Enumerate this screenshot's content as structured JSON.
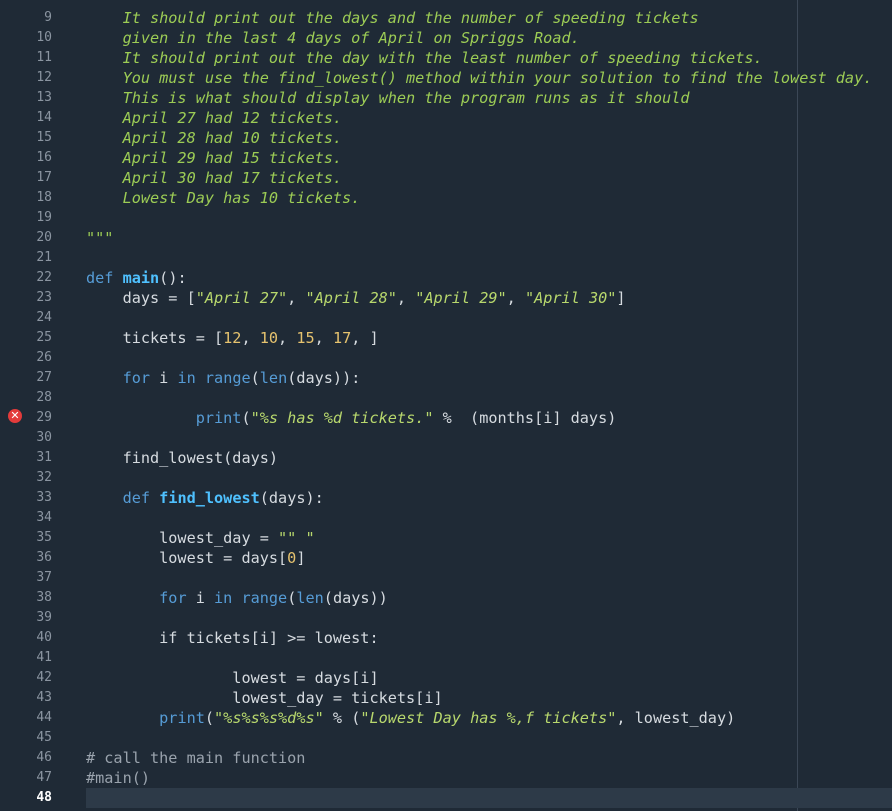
{
  "gutter": {
    "line_numbers": [
      "9",
      "10",
      "11",
      "12",
      "13",
      "14",
      "15",
      "16",
      "17",
      "18",
      "19",
      "20",
      "21",
      "22",
      "23",
      "24",
      "25",
      "26",
      "27",
      "28",
      "29",
      "30",
      "31",
      "32",
      "33",
      "34",
      "35",
      "36",
      "37",
      "38",
      "39",
      "40",
      "41",
      "42",
      "43",
      "44",
      "45",
      "46",
      "47",
      "48"
    ],
    "current_line": "48",
    "error_line": "29",
    "error_glyph": "✕"
  },
  "code": {
    "l9": "    It should print out the days and the number of speeding tickets",
    "l10": "    given in the last 4 days of April on Spriggs Road.",
    "l11": "    It should print out the day with the least number of speeding tickets.",
    "l12": "    You must use the find_lowest() method within your solution to find the lowest day.",
    "l13": "    This is what should display when the program runs as it should",
    "l14": "    April 27 had 12 tickets.",
    "l15": "    April 28 had 10 tickets.",
    "l16": "    April 29 had 15 tickets.",
    "l17": "    April 30 had 17 tickets.",
    "l18": "    Lowest Day has 10 tickets.",
    "l20": "\"\"\"",
    "l22_kw": "def",
    "l22_fn": "main",
    "l22_rest": "():",
    "l23_a": "    days = [",
    "l23_s1": "\"April 27\"",
    "l23_c1": ", ",
    "l23_s2": "\"April 28\"",
    "l23_c2": ", ",
    "l23_s3": "\"April 29\"",
    "l23_c3": ", ",
    "l23_s4": "\"April 30\"",
    "l23_end": "]",
    "l25_a": "    tickets = [",
    "l25_n1": "12",
    "l25_c1": ", ",
    "l25_n2": "10",
    "l25_c2": ", ",
    "l25_n3": "15",
    "l25_c3": ", ",
    "l25_n4": "17",
    "l25_end": ", ]",
    "l27_indent": "    ",
    "l27_for": "for",
    "l27_i": " i ",
    "l27_in": "in",
    "l27_sp": " ",
    "l27_range": "range",
    "l27_p": "(",
    "l27_len": "len",
    "l27_rest": "(days)):",
    "l29_indent": "            ",
    "l29_print": "print",
    "l29_p": "(",
    "l29_str": "\"%s has %d tickets.\"",
    "l29_rest": " %  (months[i] days)",
    "l31": "    find_lowest(days)",
    "l33_indent": "    ",
    "l33_kw": "def",
    "l33_sp": " ",
    "l33_fn": "find_lowest",
    "l33_rest": "(days):",
    "l35_a": "        lowest_day = ",
    "l35_s": "\"\" \"",
    "l36_a": "        lowest = days[",
    "l36_n": "0",
    "l36_end": "]",
    "l38_indent": "        ",
    "l38_for": "for",
    "l38_i": " i ",
    "l38_in": "in",
    "l38_sp": " ",
    "l38_range": "range",
    "l38_p": "(",
    "l38_len": "len",
    "l38_rest": "(days))",
    "l40": "        if tickets[i] >= lowest:",
    "l42": "                lowest = days[i]",
    "l43": "                lowest_day = tickets[i]",
    "l44_indent": "        ",
    "l44_print": "print",
    "l44_p": "(",
    "l44_s1": "\"%s%s%s%d%s\"",
    "l44_mid": " % (",
    "l44_s2": "\"Lowest Day has %,f tickets\"",
    "l44_end": ", lowest_day)",
    "l46": "# call the main function",
    "l47": "#main()"
  },
  "colors": {
    "background": "#1f2a36",
    "comment_string": "#9ccc55",
    "keyword": "#569cd6",
    "function": "#4fc1ff",
    "number": "#e6c36f",
    "error": "#e33b3b"
  }
}
